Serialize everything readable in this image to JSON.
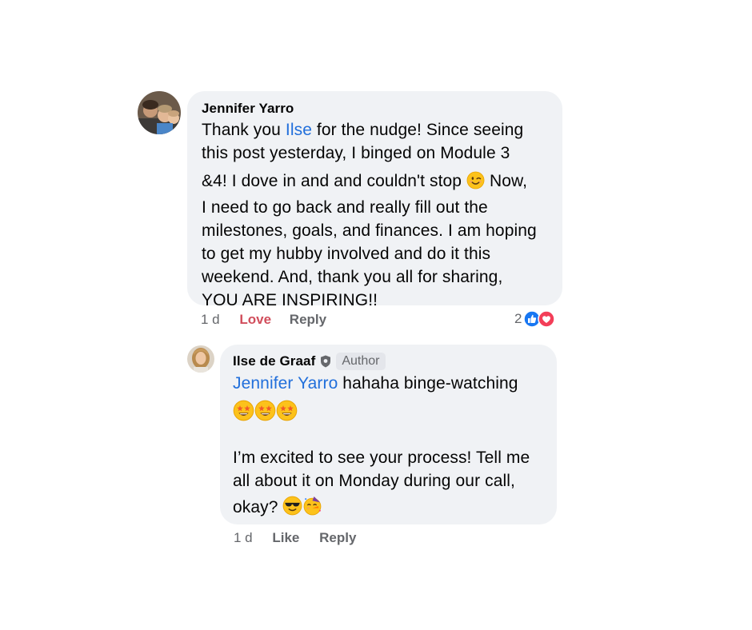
{
  "comment": {
    "author": "Jennifer Yarro",
    "text_before_mention": "Thank you ",
    "mention": "Ilse",
    "text_line_rest": " for the nudge! Since seeing",
    "line2": "this post yesterday, I binged on Module 3",
    "line3_a": "&4! I dove in and and couldn't stop ",
    "line3_b": " Now,",
    "line4": "I need to go back and really fill out the",
    "line5": "milestones, goals, and finances. I am hoping",
    "line6": "to get my hubby involved and do it this",
    "line7": "weekend. And, thank you all for sharing,",
    "line8": "YOU ARE INSPIRING!!",
    "time": "1 d",
    "love_label": "Love",
    "reply_label": "Reply",
    "reaction_count": "2",
    "reaction_icons": [
      "like-icon",
      "heart-icon"
    ],
    "emoji": "winking-face-emoji"
  },
  "reply": {
    "author": "Ilse de Graaf",
    "badge": "Author",
    "badge_icon": "shield-icon",
    "mention": "Jennifer Yarro",
    "text_after_mention": " hahaha binge-watching",
    "emoji_row": [
      "star-struck-emoji",
      "star-struck-emoji",
      "star-struck-emoji"
    ],
    "line3": "I’m excited to see your process! Tell me",
    "line4": "all about it on Monday during our call,",
    "line5": "okay? ",
    "end_emojis": [
      "sunglasses-emoji",
      "partying-face-emoji"
    ],
    "time": "1 d",
    "like_label": "Like",
    "reply_label": "Reply"
  },
  "colors": {
    "bubble_bg": "#f0f2f5",
    "link_blue": "#216fdb",
    "love_red": "#d14e5c",
    "meta_gray": "#65676b",
    "like_blue": "#1877f2",
    "heart_red": "#f33e58"
  }
}
